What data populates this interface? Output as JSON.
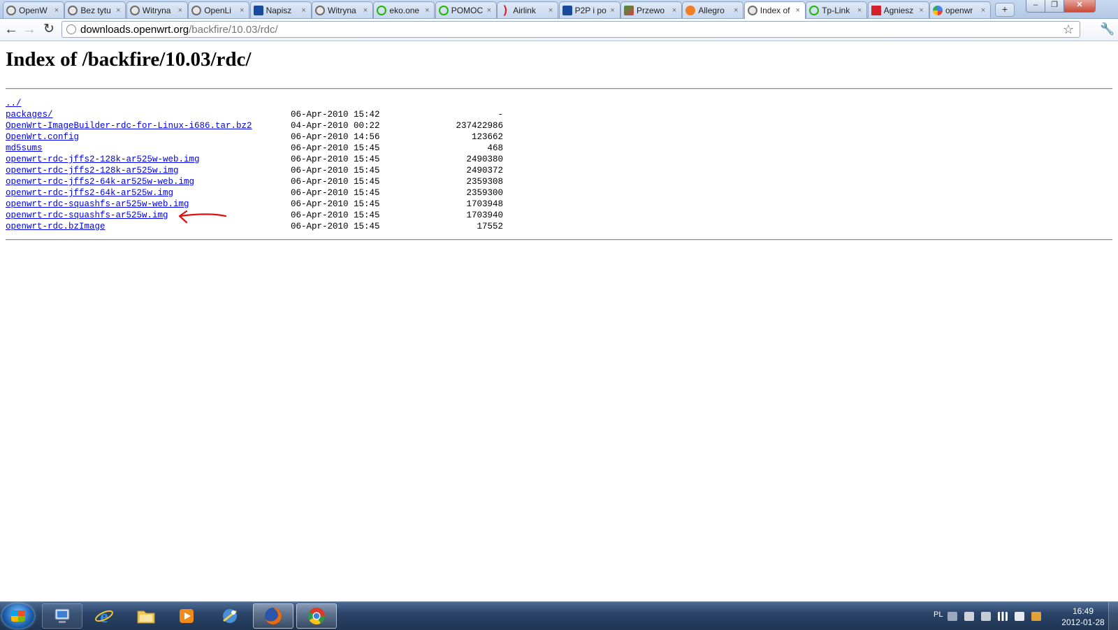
{
  "browser": {
    "tabs": [
      {
        "title": "OpenW",
        "favicon": "globe-icon"
      },
      {
        "title": "Bez tytu",
        "favicon": "blank-page-icon"
      },
      {
        "title": "Witryna",
        "favicon": "globe-icon"
      },
      {
        "title": "OpenLi",
        "favicon": "openlinux-icon"
      },
      {
        "title": "Napisz",
        "favicon": "blue-e-icon"
      },
      {
        "title": "Witryna",
        "favicon": "globe-icon"
      },
      {
        "title": "eko.one",
        "favicon": "green-circle-icon"
      },
      {
        "title": "POMOC",
        "favicon": "green-circle-icon"
      },
      {
        "title": "Airlink",
        "favicon": "red-hook-icon"
      },
      {
        "title": "P2P i po",
        "favicon": "blue-e-icon"
      },
      {
        "title": "Przewo",
        "favicon": "pen-icon"
      },
      {
        "title": "Allegro",
        "favicon": "hand-icon"
      },
      {
        "title": "Index of",
        "favicon": "globe-icon",
        "active": true
      },
      {
        "title": "Tp-Link",
        "favicon": "green-circle-icon"
      },
      {
        "title": "Agniesz",
        "favicon": "red-bookmark-icon"
      },
      {
        "title": "openwr",
        "favicon": "google-icon"
      }
    ],
    "new_tab_label": "+",
    "window_buttons": {
      "minimize": "–",
      "maximize": "❐",
      "close": "✕"
    },
    "address": {
      "host": "downloads.openwrt.org",
      "path": "/backfire/10.03/rdc/"
    }
  },
  "page": {
    "heading": "Index of /backfire/10.03/rdc/",
    "entries": [
      {
        "name": "../",
        "date": "",
        "size": ""
      },
      {
        "name": "packages/",
        "date": "06-Apr-2010 15:42",
        "size": "-"
      },
      {
        "name": "OpenWrt-ImageBuilder-rdc-for-Linux-i686.tar.bz2",
        "date": "04-Apr-2010 00:22",
        "size": "237422986"
      },
      {
        "name": "OpenWrt.config",
        "date": "06-Apr-2010 14:56",
        "size": "123662"
      },
      {
        "name": "md5sums",
        "date": "06-Apr-2010 15:45",
        "size": "468"
      },
      {
        "name": "openwrt-rdc-jffs2-128k-ar525w-web.img",
        "date": "06-Apr-2010 15:45",
        "size": "2490380"
      },
      {
        "name": "openwrt-rdc-jffs2-128k-ar525w.img",
        "date": "06-Apr-2010 15:45",
        "size": "2490372"
      },
      {
        "name": "openwrt-rdc-jffs2-64k-ar525w-web.img",
        "date": "06-Apr-2010 15:45",
        "size": "2359308"
      },
      {
        "name": "openwrt-rdc-jffs2-64k-ar525w.img",
        "date": "06-Apr-2010 15:45",
        "size": "2359300"
      },
      {
        "name": "openwrt-rdc-squashfs-ar525w-web.img",
        "date": "06-Apr-2010 15:45",
        "size": "1703948"
      },
      {
        "name": "openwrt-rdc-squashfs-ar525w.img",
        "date": "06-Apr-2010 15:45",
        "size": "1703940"
      },
      {
        "name": "openwrt-rdc.bzImage",
        "date": "06-Apr-2010 15:45",
        "size": "17552"
      }
    ],
    "link_color": "#0000ee",
    "annotation_color": "#e01010"
  },
  "taskbar": {
    "items": [
      {
        "icon": "computer-icon",
        "state": "pinned"
      },
      {
        "icon": "internet-explorer-icon",
        "state": "none"
      },
      {
        "icon": "folder-icon",
        "state": "none"
      },
      {
        "icon": "media-player-icon",
        "state": "none"
      },
      {
        "icon": "network-app-icon",
        "state": "none"
      },
      {
        "icon": "firefox-icon",
        "state": "running"
      },
      {
        "icon": "chrome-icon",
        "state": "running"
      }
    ],
    "tray": {
      "language": "PL"
    },
    "clock": {
      "time": "16:49",
      "date": "2012-01-28"
    }
  }
}
